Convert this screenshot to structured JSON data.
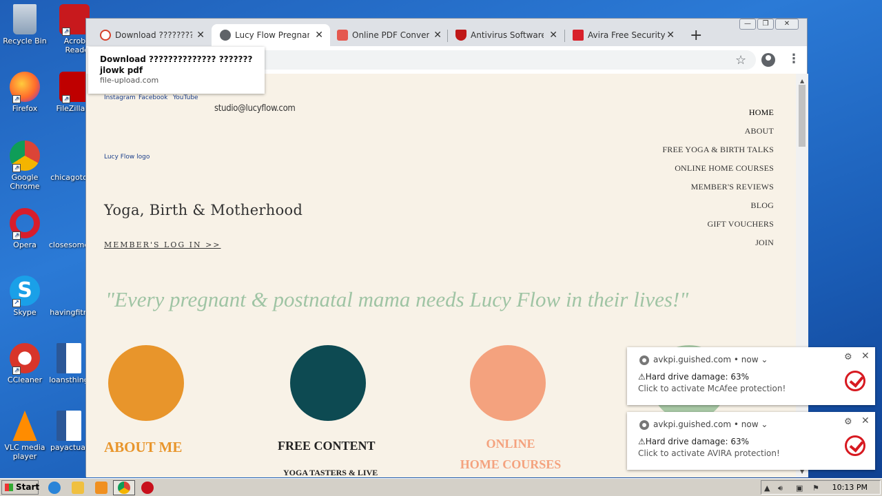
{
  "desktop": {
    "icons": [
      {
        "label": "Recycle Bin"
      },
      {
        "label": "Acrobat Reader"
      },
      {
        "label": "Firefox"
      },
      {
        "label": "FileZilla C"
      },
      {
        "label": "Google Chrome"
      },
      {
        "label": "chicagoto"
      },
      {
        "label": "Opera"
      },
      {
        "label": "closesome"
      },
      {
        "label": "Skype"
      },
      {
        "label": "havingfitn"
      },
      {
        "label": "CCleaner"
      },
      {
        "label": "loansthing"
      },
      {
        "label": "VLC media player"
      },
      {
        "label": "payactual"
      }
    ]
  },
  "browser": {
    "tabs": [
      {
        "title": "Download ???????????????",
        "icon": "pdf-icon"
      },
      {
        "title": "Lucy Flow Pregnancy Yoga",
        "icon": "globe-icon"
      },
      {
        "title": "Online PDF Converter",
        "icon": "pdf-converter-icon"
      },
      {
        "title": "Antivirus Software and",
        "icon": "mcafee-icon"
      },
      {
        "title": "Avira Free Security",
        "icon": "avira-icon"
      }
    ],
    "new_tab": "+",
    "window_buttons": {
      "minimize": "—",
      "restore": "❐",
      "close": "✕"
    },
    "tooltip": {
      "title": "Download ?????????????? ??????? jlowk pdf",
      "url": "file-upload.com"
    }
  },
  "page": {
    "social_alts": [
      "Instagram",
      "Facebook",
      "YouTube"
    ],
    "email": "studio@lucyflow.com",
    "logo_alt": "Lucy Flow logo",
    "tagline": "Yoga, Birth & Motherhood",
    "member_login": "MEMBER'S LOG IN >>",
    "nav": [
      "HOME",
      "ABOUT",
      "FREE YOGA & BIRTH TALKS",
      "ONLINE HOME COURSES",
      "MEMBER'S REVIEWS",
      "BLOG",
      "GIFT VOUCHERS",
      "JOIN"
    ],
    "quote": "\"Every pregnant & postnatal mama needs Lucy Flow in their lives!\"",
    "sections": [
      {
        "title": "ABOUT ME",
        "color": "#e8952b"
      },
      {
        "title": "FREE CONTENT",
        "color": "#0d4a52",
        "sub": "YOGA TASTERS & LIVE"
      },
      {
        "title_line1": "ONLINE",
        "title_line2": "HOME COURSES",
        "color": "#f4a27e"
      },
      {
        "color": "#a9c9a6"
      }
    ]
  },
  "notifications": [
    {
      "source": "avkpi.guished.com",
      "time": "• now ⌄",
      "title": "⚠Hard drive damage: 63%",
      "body": "Click to activate McAfee protection!"
    },
    {
      "source": "avkpi.guished.com",
      "time": "• now ⌄",
      "title": "⚠Hard drive damage: 63%",
      "body": "Click to activate AVIRA protection!"
    }
  ],
  "taskbar": {
    "start": "Start",
    "time": "10:13 PM"
  }
}
